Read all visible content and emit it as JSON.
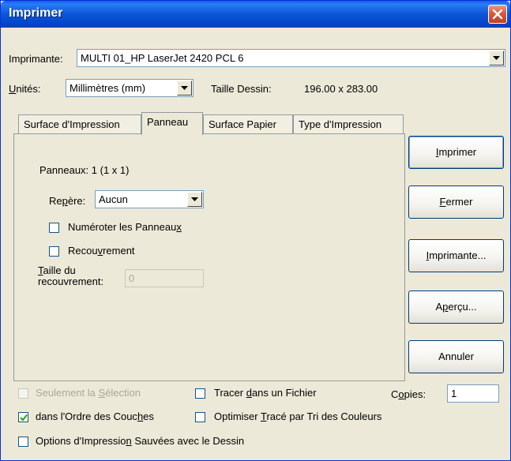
{
  "window": {
    "title": "Imprimer"
  },
  "printer": {
    "label_pre": "Imprimante:",
    "value": "MULTI 01_HP LaserJet 2420 PCL 6"
  },
  "units": {
    "label_u": "U",
    "label_rest": "nités:",
    "value": "Millimètres (mm)",
    "size_label": "Taille Dessin:",
    "size_value": "196.00 x 283.00"
  },
  "tabs": [
    {
      "label": "Surface d'Impression"
    },
    {
      "label": "Panneau"
    },
    {
      "label": "Surface Papier"
    },
    {
      "label": "Type d'Impression"
    }
  ],
  "panel": {
    "panneaux_text": "Panneaux: 1  (1 x 1)",
    "repere_label_a": "Re",
    "repere_label_u": "p",
    "repere_label_b": "ère:",
    "repere_value": "Aucun",
    "numeroter_a": "Numéroter les Panneau",
    "numeroter_u": "x",
    "recouvrement_a": "Recou",
    "recouvrement_u": "v",
    "recouvrement_b": "rement",
    "taille_u": "T",
    "taille_line1_rest": "aille du",
    "taille_line2": "recouvrement:",
    "taille_value": "0"
  },
  "buttons": {
    "imprimer_u": "I",
    "imprimer_rest": "mprimer",
    "fermer_u": "F",
    "fermer_rest": "ermer",
    "imprimante_u": "I",
    "imprimante_rest": "mprimante...",
    "apercu_a": "A",
    "apercu_u": "p",
    "apercu_b": "erçu...",
    "annuler": "Annuler"
  },
  "options": {
    "selection_a": "Seulement la ",
    "selection_u": "S",
    "selection_b": "élection",
    "ordre_a": "dans l'Ordre des Couc",
    "ordre_u": "h",
    "ordre_b": "es",
    "options_a": "Options d'Impressio",
    "options_u": "n",
    "options_b": " Sauvées avec le Dessin",
    "tracer_a": "Tracer ",
    "tracer_u": "d",
    "tracer_b": "ans un Fichier",
    "optimiser_a": "Optimiser ",
    "optimiser_u": "T",
    "optimiser_b": "racé par Tri des Couleurs",
    "copies_label_a": "C",
    "copies_label_u": "o",
    "copies_label_b": "pies:",
    "copies_value": "1"
  },
  "state": {
    "ordre_checked": true
  },
  "colors": {
    "titlebar": "#0a56d8",
    "dialog_bg": "#ece9d8",
    "close": "#d9593b"
  },
  "icons": {
    "close": "close-icon",
    "dropdown": "chevron-down-icon",
    "check": "checkmark-icon"
  }
}
